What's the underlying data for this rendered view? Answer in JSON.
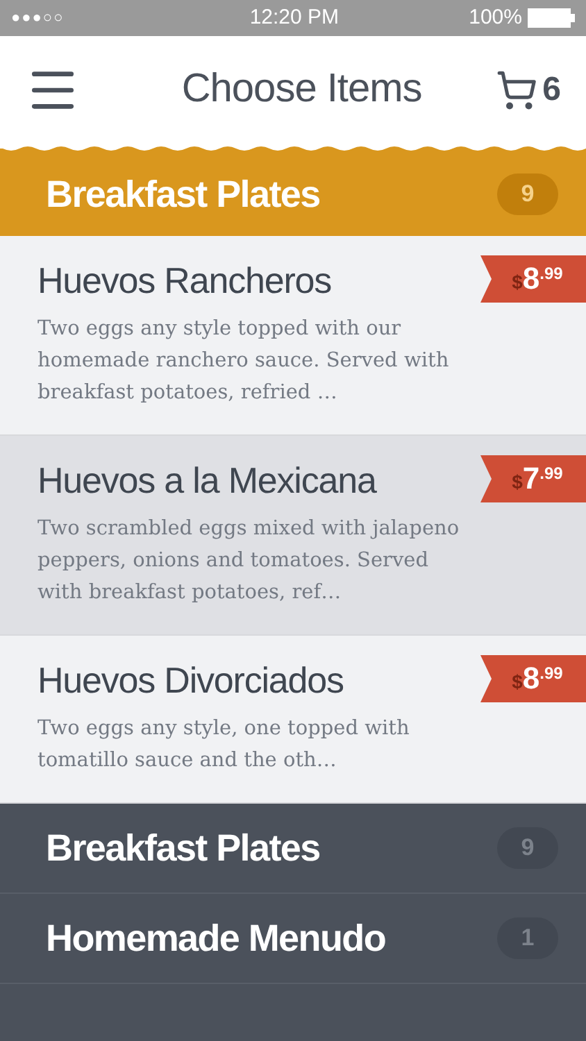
{
  "status_bar": {
    "signal": "●●●○○",
    "time": "12:20 PM",
    "battery": "100%"
  },
  "header": {
    "title": "Choose Items",
    "cart_count": "6"
  },
  "category": {
    "title": "Breakfast Plates",
    "count": "9"
  },
  "items": [
    {
      "name": "Huevos Rancheros",
      "description": "Two eggs any style topped with our homemade ranchero sauce. Served with breakfast potatoes, refried …",
      "currency": "$",
      "price": "8",
      "cents": ".99",
      "selected": false
    },
    {
      "name": "Huevos a la Mexicana",
      "description": "Two scrambled eggs mixed with jalapeno peppers, onions and tomatoes. Served with breakfast potatoes, ref…",
      "currency": "$",
      "price": "7",
      "cents": ".99",
      "selected": true
    },
    {
      "name": "Huevos Divorciados",
      "description": "Two eggs any style, one topped with tomatillo sauce and the oth…",
      "currency": "$",
      "price": "8",
      "cents": ".99",
      "selected": false
    }
  ],
  "categories": [
    {
      "title": "Breakfast Plates",
      "count": "9"
    },
    {
      "title": "Homemade Menudo",
      "count": "1"
    }
  ]
}
